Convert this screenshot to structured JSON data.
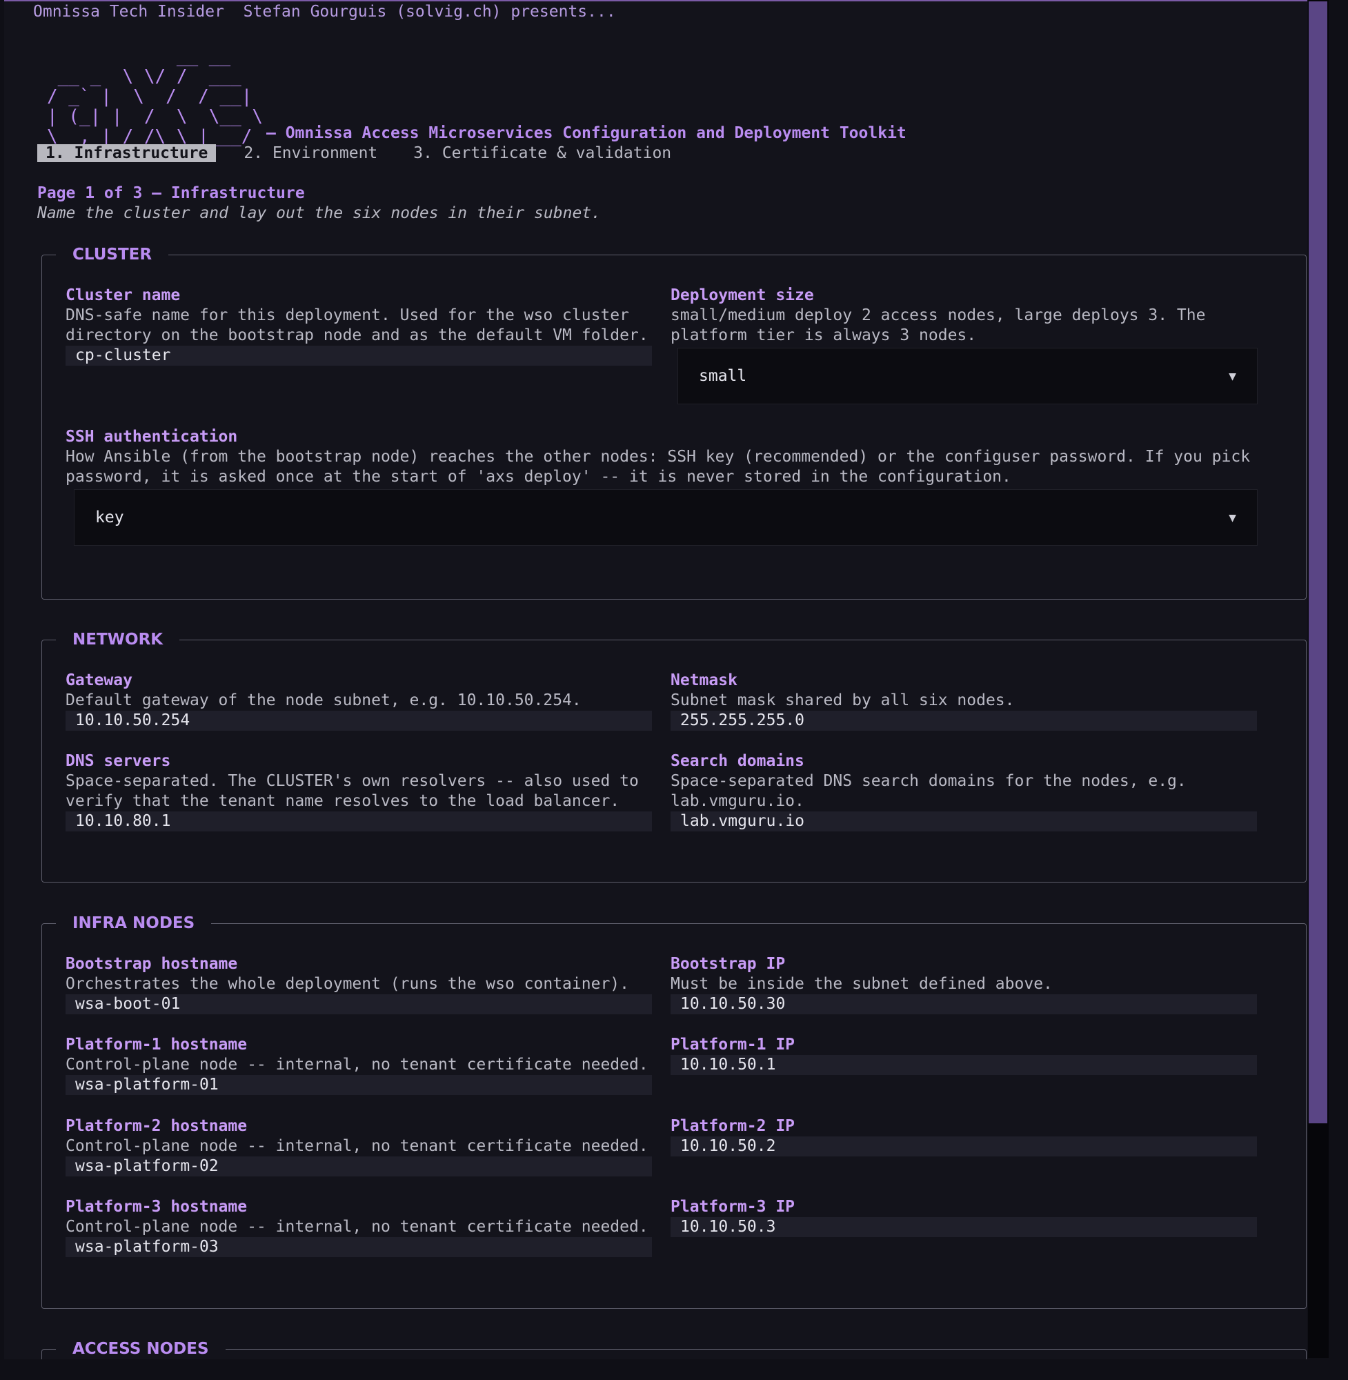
{
  "banner": "Omnissa Tech Insider  Stefan Gourguis (solvig.ch) presents...",
  "logo_ascii": "            __ __\n __ _  \\ \\/ /  ___\n/ _` |  \\  /  / __|\n| (_| |  /  \\  \\__ \\\n\\__,_| /_/\\_\\ |___/",
  "tagline": "– Omnissa Access Microservices Configuration and Deployment Toolkit",
  "steps": [
    "1. Infrastructure",
    "2. Environment",
    "3. Certificate & validation"
  ],
  "page": {
    "title": "Page 1 of 3 – Infrastructure",
    "subtitle": "Name the cluster and lay out the six nodes in their subnet."
  },
  "cluster": {
    "legend": "CLUSTER",
    "cluster_name": {
      "label": "Cluster name",
      "help": "DNS-safe name for this deployment. Used for the wso cluster directory on the bootstrap node and as the default VM folder.",
      "value": "cp-cluster"
    },
    "deployment_size": {
      "label": "Deployment size",
      "help": "small/medium deploy 2 access nodes, large deploys 3. The platform tier is always 3 nodes.",
      "value": "small"
    },
    "ssh_auth": {
      "label": "SSH authentication",
      "help": "How Ansible (from the bootstrap node) reaches the other nodes: SSH key (recommended) or the configuser password. If you pick password, it is asked once at the start of 'axs deploy' -- it is never stored in the configuration.",
      "value": "key"
    }
  },
  "network": {
    "legend": "NETWORK",
    "gateway": {
      "label": "Gateway",
      "help": "Default gateway of the node subnet, e.g. 10.10.50.254.",
      "value": "10.10.50.254"
    },
    "netmask": {
      "label": "Netmask",
      "help": "Subnet mask shared by all six nodes.",
      "value": "255.255.255.0"
    },
    "dns": {
      "label": "DNS servers",
      "help": "Space-separated. The CLUSTER's own resolvers -- also used to verify that the tenant name resolves to the load balancer.",
      "value": "10.10.80.1"
    },
    "search": {
      "label": "Search domains",
      "help": "Space-separated DNS search domains for the nodes, e.g. lab.vmguru.io.",
      "value": "lab.vmguru.io"
    }
  },
  "infra": {
    "legend": "INFRA NODES",
    "boot_host": {
      "label": "Bootstrap hostname",
      "help": "Orchestrates the whole deployment (runs the wso container).",
      "value": "wsa-boot-01"
    },
    "boot_ip": {
      "label": "Bootstrap IP",
      "help": "Must be inside the subnet defined above.",
      "value": "10.10.50.30"
    },
    "p1_host": {
      "label": "Platform-1 hostname",
      "help": "Control-plane node -- internal, no tenant certificate needed.",
      "value": "wsa-platform-01"
    },
    "p1_ip": {
      "label": "Platform-1 IP",
      "value": "10.10.50.1"
    },
    "p2_host": {
      "label": "Platform-2 hostname",
      "help": "Control-plane node -- internal, no tenant certificate needed.",
      "value": "wsa-platform-02"
    },
    "p2_ip": {
      "label": "Platform-2 IP",
      "value": "10.10.50.2"
    },
    "p3_host": {
      "label": "Platform-3 hostname",
      "help": "Control-plane node -- internal, no tenant certificate needed.",
      "value": "wsa-platform-03"
    },
    "p3_ip": {
      "label": "Platform-3 IP",
      "value": "10.10.50.3"
    }
  },
  "access": {
    "legend": "ACCESS NODES"
  },
  "icons": {
    "dropdown": "chevron-down-icon",
    "arrow_glyph": "▼"
  },
  "colors": {
    "accent": "#b98cf0",
    "border": "#7a5aa6",
    "background": "#13131b",
    "scrollbar": "#5a4585"
  }
}
